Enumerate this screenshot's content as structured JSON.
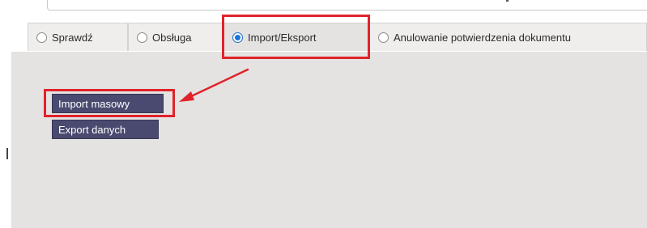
{
  "tabs": [
    {
      "label": "Sprawdź",
      "selected": false
    },
    {
      "label": "Obsługa",
      "selected": false
    },
    {
      "label": "Import/Eksport",
      "selected": true
    },
    {
      "label": "Anulowanie potwierdzenia dokumentu",
      "selected": false
    }
  ],
  "panel": {
    "buttons": {
      "import_label": "Import masowy",
      "export_label": "Export danych"
    }
  },
  "annotations": {
    "highlight_color": "#e0232b",
    "arrow_color": "#e0232b"
  },
  "colors": {
    "button_bg": "#4a4a70",
    "panel_bg": "#e4e3e1",
    "radio_checked": "#1d74d8"
  }
}
